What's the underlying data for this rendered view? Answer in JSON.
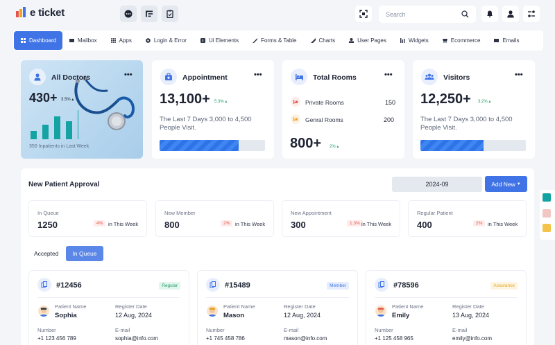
{
  "brand": {
    "name": "e ticket"
  },
  "search": {
    "placeholder": "Search"
  },
  "nav": [
    {
      "label": "Dashboard",
      "icon": "dashboard-icon",
      "active": true
    },
    {
      "label": "Mailbox",
      "icon": "mailbox-icon"
    },
    {
      "label": "Apps",
      "icon": "apps-icon"
    },
    {
      "label": "Login & Error",
      "icon": "login-icon"
    },
    {
      "label": "Ui Elements",
      "icon": "ui-elements-icon"
    },
    {
      "label": "Forms & Table",
      "icon": "forms-icon"
    },
    {
      "label": "Charts",
      "icon": "charts-icon"
    },
    {
      "label": "User Pages",
      "icon": "user-pages-icon"
    },
    {
      "label": "Widgets",
      "icon": "widgets-icon"
    },
    {
      "label": "Ecommerce",
      "icon": "ecommerce-icon"
    },
    {
      "label": "Emails",
      "icon": "emails-icon"
    }
  ],
  "stats": {
    "doctors": {
      "title": "All Doctors",
      "value": "430+",
      "change": "3.5%",
      "caption": "350 Inpatients in Last Week",
      "bars": [
        0.28,
        0.5,
        0.78,
        0.62,
        1.0
      ]
    },
    "appointment": {
      "title": "Appointment",
      "value": "13,100+",
      "change": "5.3%",
      "desc": "The Last 7 Days 3,000 to 4,500 People Visit.",
      "progress": 0.75
    },
    "rooms": {
      "title": "Total Rooms",
      "private_label": "Private Rooms",
      "private_value": "150",
      "general_label": "Genral Rooms",
      "general_value": "200",
      "value": "800+",
      "change": "2%"
    },
    "visitors": {
      "title": "Visitors",
      "value": "12,250+",
      "change": "3.2%",
      "desc": "The Last 7 Days 3,000 to 4,500 People Visit.",
      "progress": 0.6
    }
  },
  "approval": {
    "title": "New Patient Approval",
    "date": "2024-09",
    "add_label": "Add New",
    "queues": [
      {
        "label": "In Queue",
        "value": "1250",
        "pct": "4%",
        "note": "in This Week"
      },
      {
        "label": "New Member",
        "value": "800",
        "pct": "2%",
        "note": "in This Week"
      },
      {
        "label": "New Appointment",
        "value": "300",
        "pct": "1.3%",
        "note": "in This Week"
      },
      {
        "label": "Regular Patient",
        "value": "400",
        "pct": "2%",
        "note": "in This Week"
      }
    ],
    "tabs": {
      "accepted": "Accepted",
      "in_queue": "In Queue"
    },
    "labels": {
      "patient_name": "Patient Name",
      "register_date": "Register Date",
      "number": "Number",
      "email": "E-mail"
    },
    "patients": [
      {
        "id": "#12456",
        "badge": "Regular",
        "badge_color": "#22a06b",
        "badge_bg": "#e3f6ee",
        "name": "Sophia",
        "date": "12 Aug, 2024",
        "number": "+1 123 456 789",
        "email": "sophia@info.com"
      },
      {
        "id": "#15489",
        "badge": "Member",
        "badge_color": "#3f73e6",
        "badge_bg": "#e6edfc",
        "name": "Mason",
        "date": "12 Aug, 2024",
        "number": "+1 745 458 786",
        "email": "mason@info.com"
      },
      {
        "id": "#78596",
        "badge": "Assurance",
        "badge_color": "#e3a21a",
        "badge_bg": "#fdf4e1",
        "name": "Emily",
        "date": "13 Aug, 2024",
        "number": "+1 125 458 965",
        "email": "emily@info.com"
      }
    ]
  },
  "colors": {
    "accent": "#3f73e6",
    "positive": "#22a06b",
    "negative": "#e2574c",
    "teal": "#14a3a3"
  }
}
